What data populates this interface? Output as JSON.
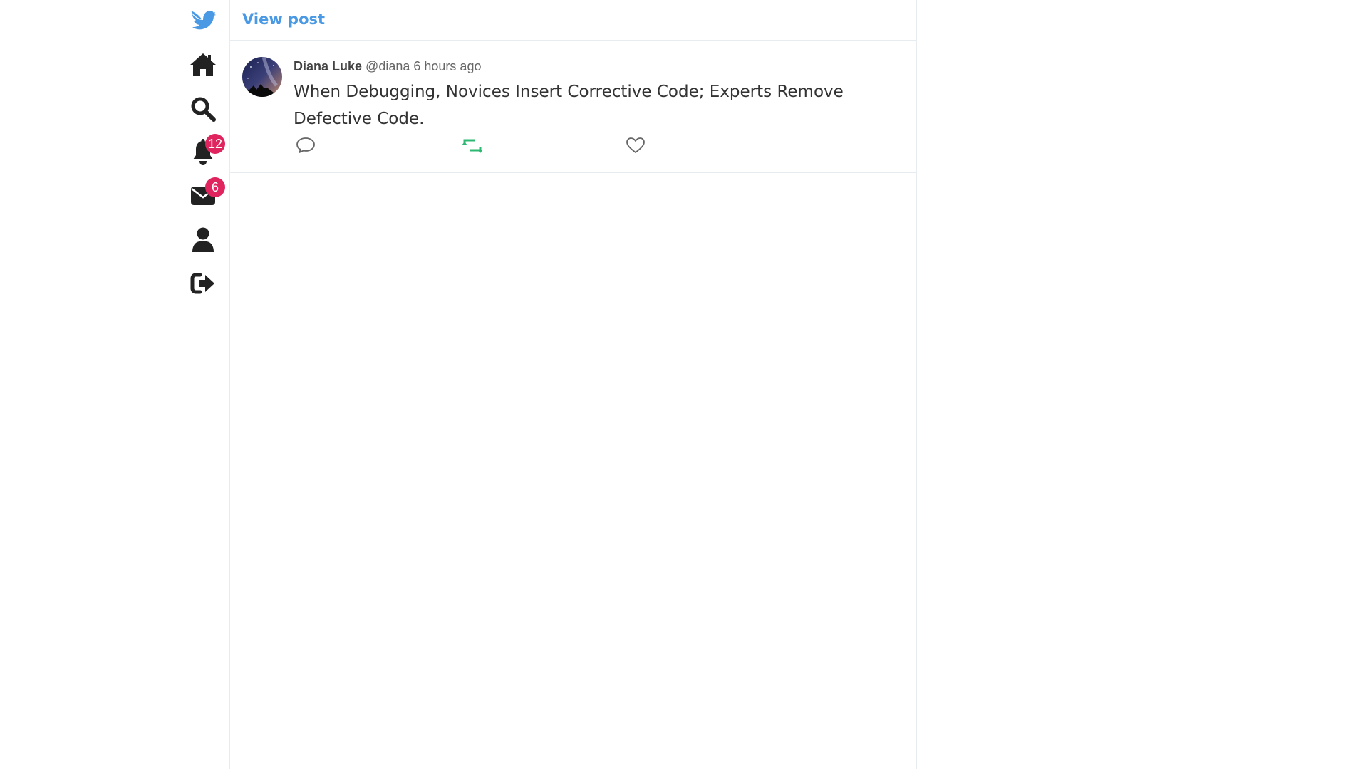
{
  "app": {
    "brand_color": "#4a99e4",
    "logo_icon": "bird-icon"
  },
  "sidebar": {
    "items": [
      {
        "name": "home",
        "icon": "home-icon"
      },
      {
        "name": "search",
        "icon": "search-icon"
      },
      {
        "name": "notifications",
        "icon": "bell-icon",
        "badge": "12"
      },
      {
        "name": "messages",
        "icon": "envelope-icon",
        "badge": "6"
      },
      {
        "name": "profile",
        "icon": "user-icon"
      },
      {
        "name": "logout",
        "icon": "sign-out-icon"
      }
    ],
    "badge_color": "#e0245e"
  },
  "header": {
    "title": "View post"
  },
  "post": {
    "author_name": "Diana Luke",
    "handle": "@diana",
    "time": "6 hours ago",
    "text": "When Debugging, Novices Insert Corrective Code; Experts Remove Defective Code.",
    "actions": {
      "reply_icon": "comment-icon",
      "repost_icon": "retweet-icon",
      "repost_color": "#2eb872",
      "like_icon": "heart-icon"
    }
  }
}
